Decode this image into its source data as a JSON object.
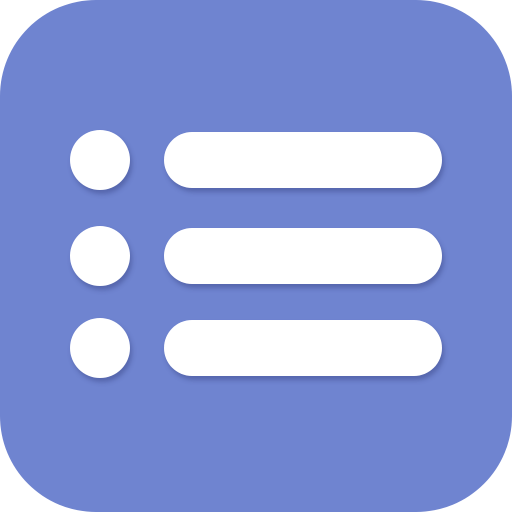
{
  "icon": {
    "name": "list-icon",
    "background_color": "#6f84d0",
    "foreground_color": "#ffffff",
    "rows": [
      {
        "bullet": "bullet-dot",
        "line": "list-line"
      },
      {
        "bullet": "bullet-dot",
        "line": "list-line"
      },
      {
        "bullet": "bullet-dot",
        "line": "list-line"
      }
    ]
  }
}
